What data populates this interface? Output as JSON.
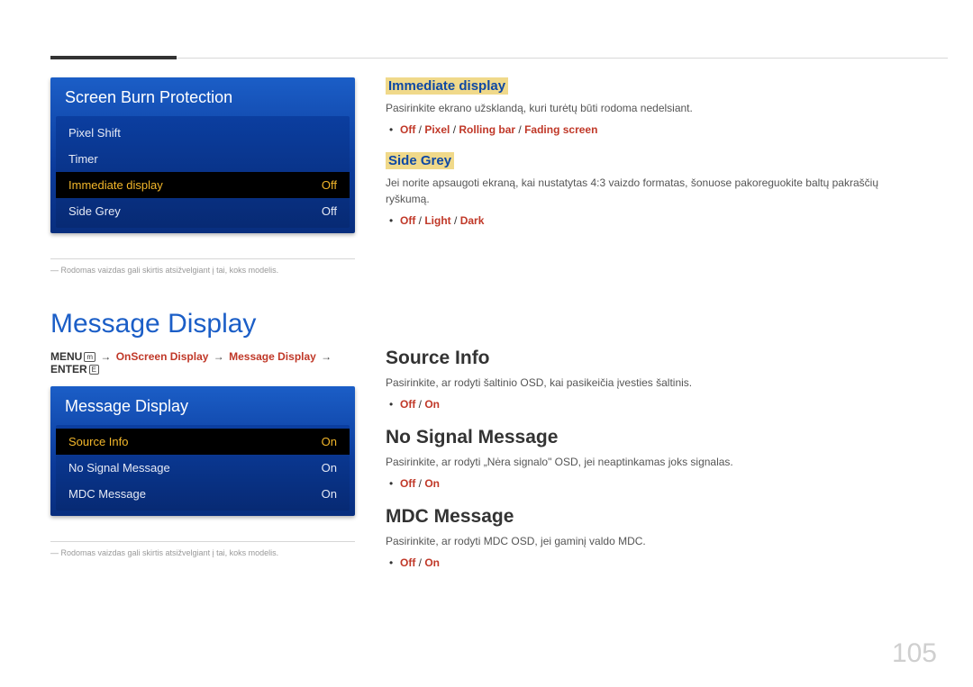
{
  "page_number": "105",
  "top_section": {
    "osd1": {
      "title": "Screen Burn Protection",
      "rows": [
        {
          "label": "Pixel Shift",
          "value": ""
        },
        {
          "label": "Timer",
          "value": ""
        },
        {
          "label": "Immediate display",
          "value": "Off",
          "active": true
        },
        {
          "label": "Side Grey",
          "value": "Off"
        }
      ]
    },
    "footnote1": "― Rodomas vaizdas gali skirtis atsižvelgiant į tai, koks modelis.",
    "immediate": {
      "heading": "Immediate display",
      "para": "Pasirinkite ekrano užsklandą, kuri turėtų būti rodoma nedelsiant.",
      "options": [
        "Off",
        "Pixel",
        "Rolling bar",
        "Fading screen"
      ]
    },
    "side_grey": {
      "heading": "Side Grey",
      "para": "Jei norite apsaugoti ekraną, kai nustatytas 4:3 vaizdo formatas, šonuose pakoreguokite baltų pakraščių ryškumą.",
      "options": [
        "Off",
        "Light",
        "Dark"
      ]
    }
  },
  "msg_display": {
    "title": "Message Display",
    "path": {
      "menu": "MENU",
      "p1": "OnScreen Display",
      "p2": "Message Display",
      "enter": "ENTER"
    },
    "osd2": {
      "title": "Message Display",
      "rows": [
        {
          "label": "Source Info",
          "value": "On",
          "active": true
        },
        {
          "label": "No Signal Message",
          "value": "On"
        },
        {
          "label": "MDC Message",
          "value": "On"
        }
      ]
    },
    "footnote2": "― Rodomas vaizdas gali skirtis atsižvelgiant į tai, koks modelis.",
    "source_info": {
      "heading": "Source Info",
      "para": "Pasirinkite, ar rodyti šaltinio OSD, kai pasikeičia įvesties šaltinis.",
      "options": [
        "Off",
        "On"
      ]
    },
    "no_signal": {
      "heading": "No Signal Message",
      "para": "Pasirinkite, ar rodyti „Nėra signalo\" OSD, jei neaptinkamas joks signalas.",
      "options": [
        "Off",
        "On"
      ]
    },
    "mdc": {
      "heading": "MDC Message",
      "para": "Pasirinkite, ar rodyti MDC OSD, jei gaminį valdo MDC.",
      "options": [
        "Off",
        "On"
      ]
    }
  }
}
